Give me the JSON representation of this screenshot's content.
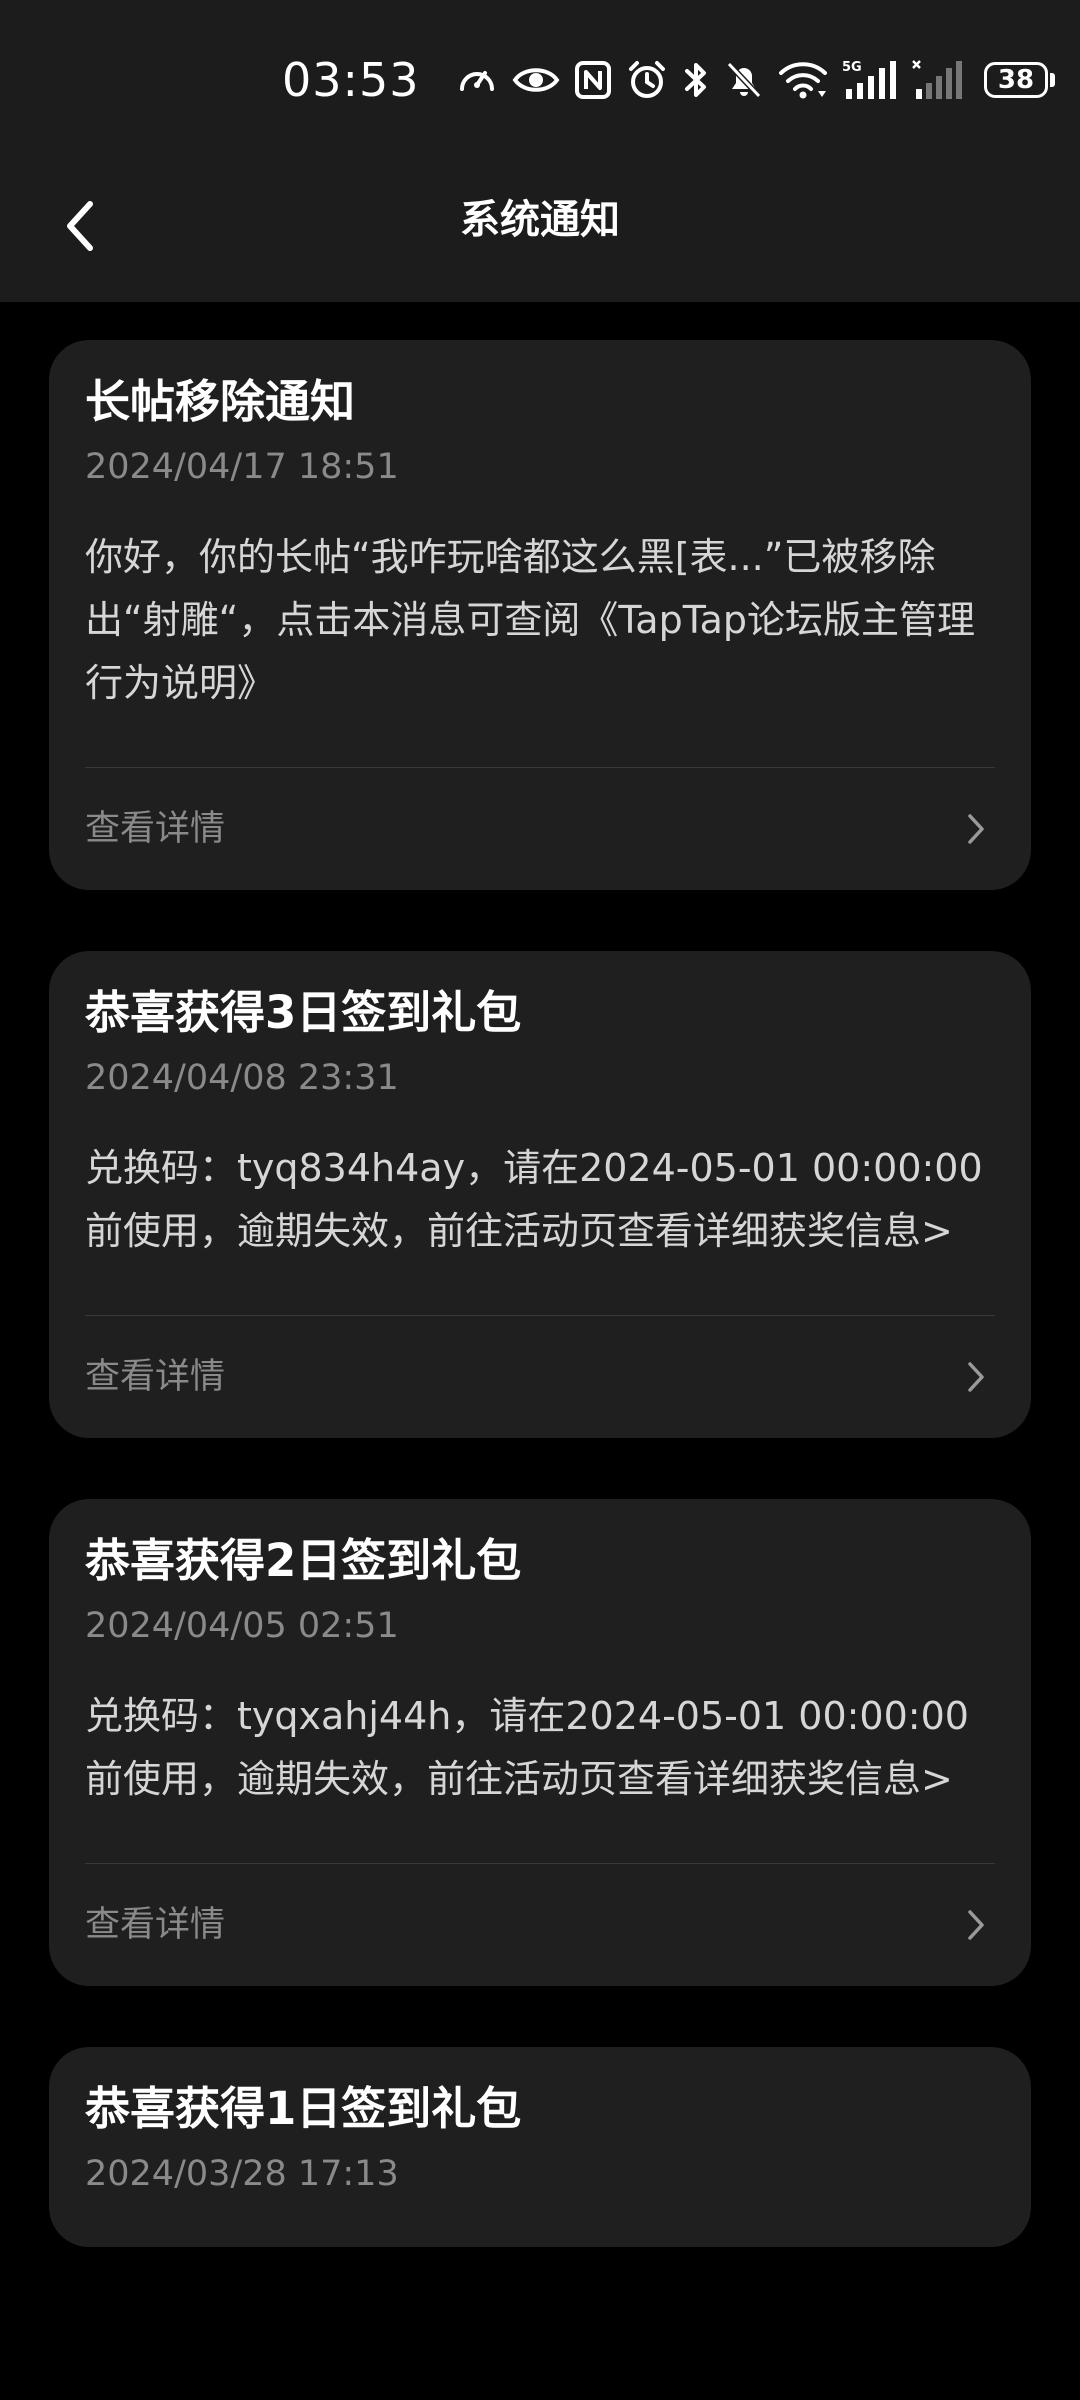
{
  "status_bar": {
    "time": "03:53",
    "battery": "38"
  },
  "header": {
    "title": "系统通知"
  },
  "notifications": [
    {
      "title": "长帖移除通知",
      "time": "2024/04/17 18:51",
      "body": "你好，你的长帖“我咋玩啥都这么黑[表...”已被移除出“射雕“，点击本消息可查阅《TapTap论坛版主管理行为说明》",
      "action": "查看详情"
    },
    {
      "title": "恭喜获得3日签到礼包",
      "time": "2024/04/08 23:31",
      "body": "兑换码：tyq834h4ay，请在2024-05-01 00:00:00前使用，逾期失效，前往活动页查看详细获奖信息>",
      "action": "查看详情"
    },
    {
      "title": "恭喜获得2日签到礼包",
      "time": "2024/04/05 02:51",
      "body": "兑换码：tyqxahj44h，请在2024-05-01 00:00:00前使用，逾期失效，前往活动页查看详细获奖信息>",
      "action": "查看详情"
    },
    {
      "title": "恭喜获得1日签到礼包",
      "time": "2024/03/28 17:13"
    }
  ],
  "colors": {
    "background": "#000000",
    "bar": "#1c1c1c",
    "card": "#1f1f1f",
    "secondary_text": "#8a8a8a"
  },
  "icons": [
    "speedometer-icon",
    "eye-icon",
    "nfc-icon",
    "alarm-icon",
    "bluetooth-icon",
    "mute-icon",
    "wifi-icon",
    "signal-5g-icon",
    "signal-no-service-icon",
    "battery-icon",
    "back-arrow-icon",
    "chevron-right-icon"
  ]
}
